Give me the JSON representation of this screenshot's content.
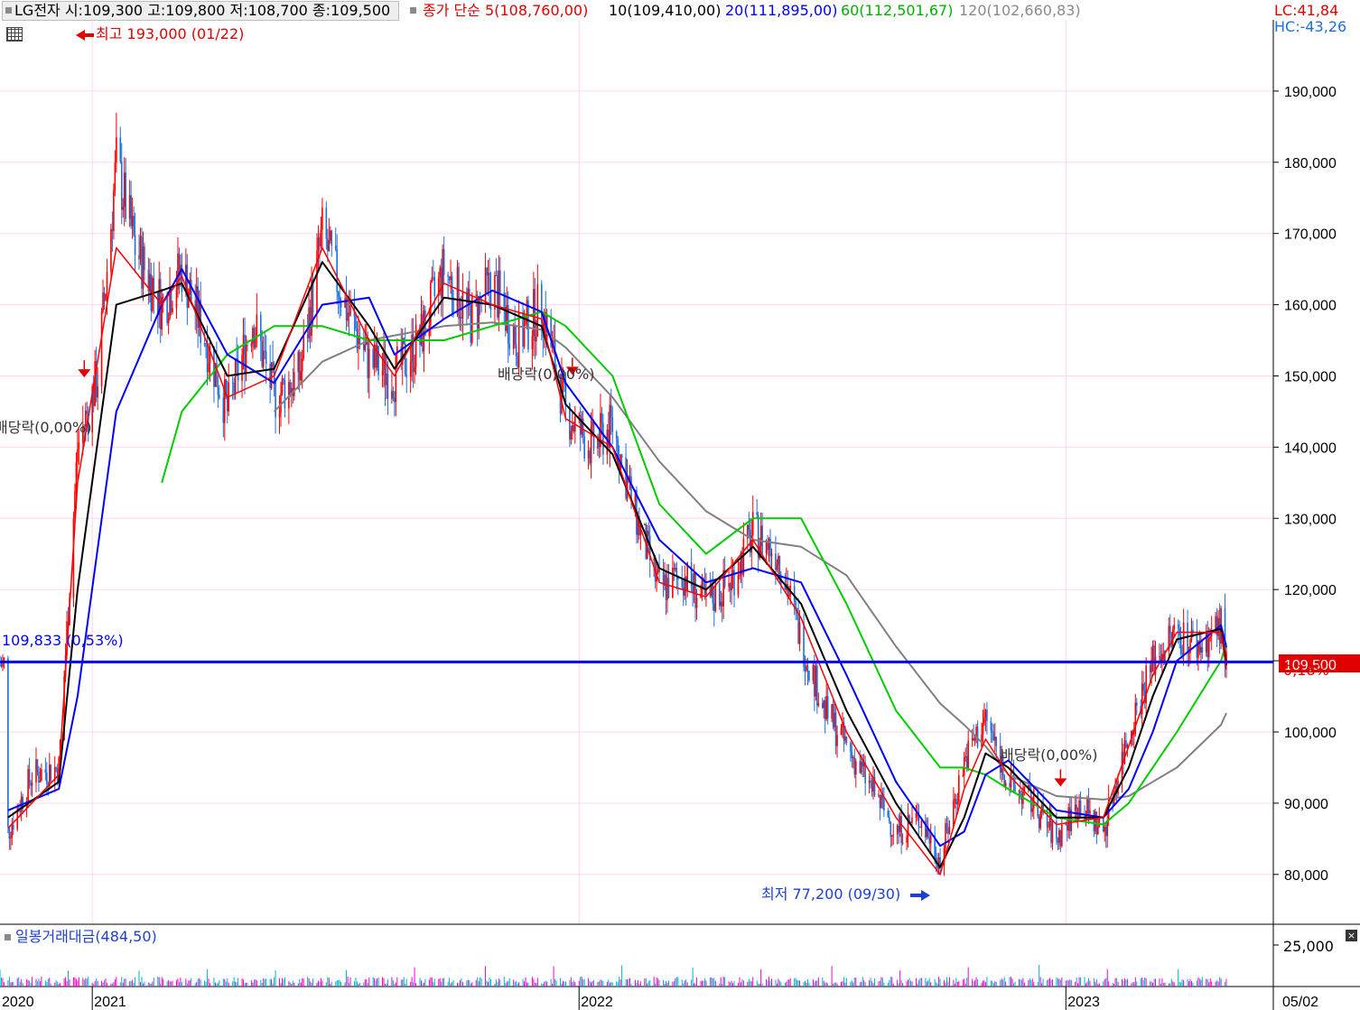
{
  "header": {
    "stock_info": "LG전자 시:109,300 고:109,800 저:108,700 종:109,500",
    "ma_title": "종가 단순 5(108,760,00)",
    "ma10": "10(109,410,00)",
    "ma20": "20(111,895,00)",
    "ma60": "60(112,501,67)",
    "ma120": "120(102,660,83)",
    "lc": "LC:41,84",
    "hc": "HC:-43,26"
  },
  "colors": {
    "candle_up": "#ff0000",
    "candle_down": "#1e6fd9",
    "ma5": "#ff0000",
    "ma10": "#000000",
    "ma20": "#0000ff",
    "ma60": "#00cc00",
    "ma120": "#808080",
    "hline": "#0000ff",
    "grid": "#ffd6f0",
    "vol_up": "#ff00cc",
    "vol_down": "#00b4c8"
  },
  "annotations": {
    "high": "최고 193,000 (01/22)",
    "low": "최저 77,200 (09/30)",
    "div1": "배당락(0,00%)",
    "div2": "배당락(0,00%)",
    "div3": "배당락(0,00%)",
    "hline_label": "109,833 (0,53%)",
    "current_price": "109,500",
    "current_change": "0,18%"
  },
  "volume_panel": {
    "title": "일봉거래대금(484,50)",
    "axis_label": "25,000"
  },
  "chart_data": {
    "type": "candlestick",
    "title": "LG전자",
    "ylim": [
      73000,
      200000
    ],
    "y_ticks": [
      80000,
      90000,
      100000,
      110000,
      120000,
      130000,
      140000,
      150000,
      160000,
      170000,
      180000,
      190000
    ],
    "y_tick_labels": [
      "80,000",
      "90,000",
      "100,000",
      "110,000",
      "120,000",
      "130,000",
      "140,000",
      "150,000",
      "160,000",
      "170,000",
      "180,000",
      "190,000"
    ],
    "x_labels": [
      "2020",
      "2021",
      "2022",
      "2023",
      "05/02"
    ],
    "current_price": 109500,
    "reference_line": 109833,
    "high": {
      "value": 193000,
      "date": "01/22"
    },
    "low": {
      "value": 77200,
      "date": "09/30"
    },
    "close_path": [
      [
        "2020-11-02",
        86000
      ],
      [
        "2020-11-20",
        94000
      ],
      [
        "2020-12-10",
        95000
      ],
      [
        "2020-12-24",
        140000
      ],
      [
        "2021-01-08",
        150000
      ],
      [
        "2021-01-22",
        180000
      ],
      [
        "2021-02-05",
        168000
      ],
      [
        "2021-02-25",
        160000
      ],
      [
        "2021-03-12",
        165000
      ],
      [
        "2021-03-30",
        155000
      ],
      [
        "2021-04-15",
        145000
      ],
      [
        "2021-05-04",
        158000
      ],
      [
        "2021-05-20",
        147000
      ],
      [
        "2021-06-08",
        150000
      ],
      [
        "2021-06-25",
        170000
      ],
      [
        "2021-07-12",
        160000
      ],
      [
        "2021-07-30",
        152000
      ],
      [
        "2021-08-18",
        150000
      ],
      [
        "2021-09-06",
        155000
      ],
      [
        "2021-09-24",
        165000
      ],
      [
        "2021-10-14",
        158000
      ],
      [
        "2021-10-30",
        163000
      ],
      [
        "2021-11-18",
        155000
      ],
      [
        "2021-12-06",
        160000
      ],
      [
        "2021-12-24",
        145000
      ],
      [
        "2022-01-12",
        140000
      ],
      [
        "2022-01-28",
        143000
      ],
      [
        "2022-02-15",
        130000
      ],
      [
        "2022-03-04",
        120000
      ],
      [
        "2022-03-22",
        122000
      ],
      [
        "2022-04-08",
        118000
      ],
      [
        "2022-04-26",
        121000
      ],
      [
        "2022-05-13",
        128000
      ],
      [
        "2022-06-01",
        125000
      ],
      [
        "2022-06-18",
        113000
      ],
      [
        "2022-07-06",
        103000
      ],
      [
        "2022-07-22",
        98000
      ],
      [
        "2022-08-10",
        92000
      ],
      [
        "2022-08-28",
        86000
      ],
      [
        "2022-09-15",
        88000
      ],
      [
        "2022-09-30",
        82000
      ],
      [
        "2022-10-18",
        96000
      ],
      [
        "2022-11-03",
        102000
      ],
      [
        "2022-11-20",
        93000
      ],
      [
        "2022-12-08",
        90000
      ],
      [
        "2022-12-26",
        85000
      ],
      [
        "2023-01-12",
        90000
      ],
      [
        "2023-01-30",
        86000
      ],
      [
        "2023-02-18",
        100000
      ],
      [
        "2023-03-08",
        110000
      ],
      [
        "2023-03-26",
        114000
      ],
      [
        "2023-04-12",
        112000
      ],
      [
        "2023-04-28",
        115000
      ],
      [
        "2023-05-02",
        109500
      ]
    ],
    "moving_averages": [
      {
        "name": "5",
        "points": [
          [
            "2020-11-02",
            86500
          ],
          [
            "2020-12-10",
            94000
          ],
          [
            "2020-12-24",
            135000
          ],
          [
            "2021-01-22",
            168000
          ],
          [
            "2021-02-25",
            160000
          ],
          [
            "2021-03-12",
            164000
          ],
          [
            "2021-04-15",
            147000
          ],
          [
            "2021-05-20",
            150000
          ],
          [
            "2021-06-25",
            168000
          ],
          [
            "2021-07-30",
            155000
          ],
          [
            "2021-08-18",
            150000
          ],
          [
            "2021-09-24",
            163000
          ],
          [
            "2021-10-30",
            160000
          ],
          [
            "2021-12-06",
            158000
          ],
          [
            "2021-12-24",
            144000
          ],
          [
            "2022-01-28",
            140000
          ],
          [
            "2022-03-04",
            121000
          ],
          [
            "2022-04-08",
            119000
          ],
          [
            "2022-05-13",
            127000
          ],
          [
            "2022-06-18",
            116000
          ],
          [
            "2022-07-22",
            100000
          ],
          [
            "2022-08-28",
            88000
          ],
          [
            "2022-09-30",
            80000
          ],
          [
            "2022-10-18",
            92000
          ],
          [
            "2022-11-03",
            99000
          ],
          [
            "2022-11-20",
            94000
          ],
          [
            "2022-12-26",
            87000
          ],
          [
            "2023-01-30",
            88000
          ],
          [
            "2023-02-18",
            98000
          ],
          [
            "2023-03-08",
            108000
          ],
          [
            "2023-03-26",
            114000
          ],
          [
            "2023-04-28",
            114000
          ],
          [
            "2023-05-02",
            108760
          ]
        ]
      },
      {
        "name": "10",
        "points": [
          [
            "2020-11-02",
            88000
          ],
          [
            "2020-12-10",
            93000
          ],
          [
            "2020-12-24",
            120000
          ],
          [
            "2021-01-22",
            160000
          ],
          [
            "2021-02-25",
            162000
          ],
          [
            "2021-03-12",
            163000
          ],
          [
            "2021-04-15",
            150000
          ],
          [
            "2021-05-20",
            151000
          ],
          [
            "2021-06-25",
            166000
          ],
          [
            "2021-07-30",
            157000
          ],
          [
            "2021-08-18",
            151000
          ],
          [
            "2021-09-24",
            161000
          ],
          [
            "2021-10-30",
            160000
          ],
          [
            "2021-12-06",
            157000
          ],
          [
            "2021-12-24",
            146000
          ],
          [
            "2022-01-28",
            139000
          ],
          [
            "2022-03-04",
            123000
          ],
          [
            "2022-04-08",
            120000
          ],
          [
            "2022-05-13",
            126000
          ],
          [
            "2022-06-18",
            118000
          ],
          [
            "2022-07-22",
            103000
          ],
          [
            "2022-08-28",
            90000
          ],
          [
            "2022-09-30",
            81000
          ],
          [
            "2022-10-18",
            88000
          ],
          [
            "2022-11-03",
            97000
          ],
          [
            "2022-11-20",
            95000
          ],
          [
            "2022-12-26",
            88000
          ],
          [
            "2023-01-30",
            88000
          ],
          [
            "2023-02-18",
            95000
          ],
          [
            "2023-03-08",
            105000
          ],
          [
            "2023-03-26",
            113000
          ],
          [
            "2023-04-28",
            114500
          ],
          [
            "2023-05-02",
            109410
          ]
        ]
      },
      {
        "name": "20",
        "points": [
          [
            "2020-11-02",
            89000
          ],
          [
            "2020-12-10",
            92000
          ],
          [
            "2020-12-24",
            105000
          ],
          [
            "2021-01-22",
            145000
          ],
          [
            "2021-02-25",
            160000
          ],
          [
            "2021-03-12",
            165000
          ],
          [
            "2021-04-15",
            153000
          ],
          [
            "2021-05-20",
            149000
          ],
          [
            "2021-06-25",
            160000
          ],
          [
            "2021-07-30",
            161000
          ],
          [
            "2021-08-18",
            153000
          ],
          [
            "2021-09-24",
            158000
          ],
          [
            "2021-10-30",
            162000
          ],
          [
            "2021-12-06",
            159000
          ],
          [
            "2021-12-24",
            149000
          ],
          [
            "2022-01-28",
            140000
          ],
          [
            "2022-03-04",
            127000
          ],
          [
            "2022-04-08",
            121000
          ],
          [
            "2022-05-13",
            123000
          ],
          [
            "2022-06-18",
            121000
          ],
          [
            "2022-07-22",
            108000
          ],
          [
            "2022-08-28",
            93000
          ],
          [
            "2022-09-30",
            84000
          ],
          [
            "2022-10-18",
            86000
          ],
          [
            "2022-11-03",
            94000
          ],
          [
            "2022-11-20",
            96000
          ],
          [
            "2022-12-26",
            89000
          ],
          [
            "2023-01-30",
            88000
          ],
          [
            "2023-02-18",
            92000
          ],
          [
            "2023-03-08",
            100000
          ],
          [
            "2023-03-26",
            110000
          ],
          [
            "2023-04-28",
            115000
          ],
          [
            "2023-05-02",
            111895
          ]
        ]
      },
      {
        "name": "60",
        "points": [
          [
            "2021-02-25",
            135000
          ],
          [
            "2021-03-12",
            145000
          ],
          [
            "2021-04-15",
            153000
          ],
          [
            "2021-05-20",
            157000
          ],
          [
            "2021-06-25",
            157000
          ],
          [
            "2021-07-30",
            155000
          ],
          [
            "2021-08-18",
            155000
          ],
          [
            "2021-09-24",
            155000
          ],
          [
            "2021-10-30",
            157000
          ],
          [
            "2021-12-06",
            159000
          ],
          [
            "2021-12-24",
            157000
          ],
          [
            "2022-01-28",
            150000
          ],
          [
            "2022-03-04",
            132000
          ],
          [
            "2022-04-08",
            125000
          ],
          [
            "2022-05-13",
            130000
          ],
          [
            "2022-06-18",
            130000
          ],
          [
            "2022-07-22",
            118000
          ],
          [
            "2022-08-28",
            103000
          ],
          [
            "2022-09-30",
            95000
          ],
          [
            "2022-10-18",
            95000
          ],
          [
            "2022-11-03",
            94000
          ],
          [
            "2022-11-20",
            92000
          ],
          [
            "2022-12-26",
            88000
          ],
          [
            "2023-01-30",
            87000
          ],
          [
            "2023-02-18",
            90000
          ],
          [
            "2023-03-08",
            95000
          ],
          [
            "2023-03-26",
            100000
          ],
          [
            "2023-04-28",
            110000
          ],
          [
            "2023-05-02",
            112502
          ]
        ]
      },
      {
        "name": "120",
        "points": [
          [
            "2021-05-20",
            145000
          ],
          [
            "2021-06-25",
            152000
          ],
          [
            "2021-07-30",
            155000
          ],
          [
            "2021-09-24",
            157000
          ],
          [
            "2021-10-30",
            157500
          ],
          [
            "2021-12-06",
            156500
          ],
          [
            "2021-12-24",
            154000
          ],
          [
            "2022-01-28",
            147000
          ],
          [
            "2022-03-04",
            138000
          ],
          [
            "2022-04-08",
            131000
          ],
          [
            "2022-05-13",
            127000
          ],
          [
            "2022-06-18",
            126000
          ],
          [
            "2022-07-22",
            122000
          ],
          [
            "2022-08-28",
            112000
          ],
          [
            "2022-09-30",
            104000
          ],
          [
            "2022-10-18",
            101000
          ],
          [
            "2022-11-03",
            98000
          ],
          [
            "2022-11-20",
            94000
          ],
          [
            "2022-12-26",
            91000
          ],
          [
            "2023-01-30",
            90500
          ],
          [
            "2023-02-18",
            91000
          ],
          [
            "2023-03-08",
            93000
          ],
          [
            "2023-03-26",
            95000
          ],
          [
            "2023-04-28",
            101000
          ],
          [
            "2023-05-02",
            102661
          ]
        ]
      }
    ],
    "dividend_markers": [
      {
        "date": "2020-12-29",
        "label": "배당락(0,00%)"
      },
      {
        "date": "2021-12-29",
        "label": "배당락(0,00%)"
      },
      {
        "date": "2022-12-29",
        "label": "배당락(0,00%)"
      }
    ]
  }
}
